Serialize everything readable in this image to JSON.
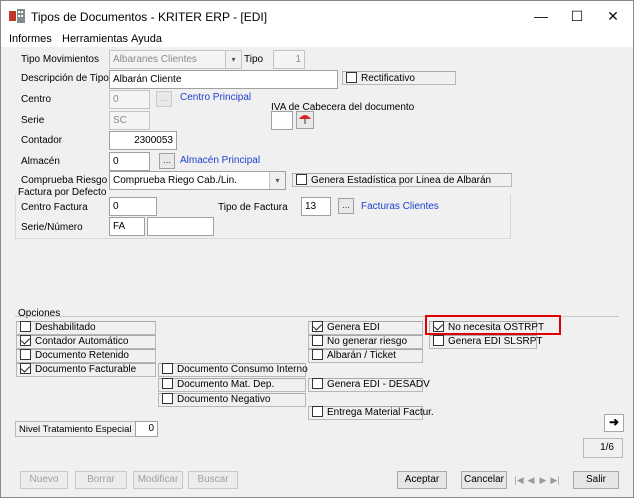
{
  "window": {
    "title": "Tipos de Documentos - KRITER ERP - [EDI]",
    "minimize": "—",
    "maximize": "☐",
    "close": "✕"
  },
  "menu": [
    "Informes",
    "Herramientas",
    "Ayuda"
  ],
  "form": {
    "tipo_movimientos": {
      "label": "Tipo Movimientos",
      "value": "Albaranes Clientes"
    },
    "tipo": {
      "label": "Tipo",
      "value": "1"
    },
    "descripcion": {
      "label": "Descripción de Tipo",
      "value": "Albarán Cliente"
    },
    "rectificativo": {
      "label": "Rectificativo",
      "checked": false
    },
    "centro": {
      "label": "Centro",
      "value": "0",
      "link": "Centro Principal"
    },
    "serie": {
      "label": "Serie",
      "value": "SC"
    },
    "iva": {
      "label": "IVA de Cabecera del documento",
      "value": ""
    },
    "contador": {
      "label": "Contador",
      "value": "2300053"
    },
    "almacen": {
      "label": "Almacén",
      "value": "0",
      "link": "Almacén Principal"
    },
    "compruebe_riesgo": {
      "label": "Comprueba Riesgo",
      "value": "Comprueba Riego Cab./Lin."
    },
    "genera_estadistica": {
      "label": "Genera Estadística por Linea de Albarán",
      "checked": false
    },
    "lookup_button": "...",
    "factura_group": {
      "title": "Factura por Defecto",
      "centro_factura": {
        "label": "Centro Factura",
        "value": "0"
      },
      "tipo_factura": {
        "label": "Tipo de Factura",
        "value": "13",
        "link": "Facturas Clientes"
      },
      "serie_numero": {
        "label": "Serie/Número",
        "value": "FA",
        "value2": ""
      }
    }
  },
  "opciones": {
    "title": "Opciones",
    "col1": [
      {
        "label": "Deshabilitado",
        "checked": false
      },
      {
        "label": "Contador Automático",
        "checked": true
      },
      {
        "label": "Documento Retenido",
        "checked": false
      },
      {
        "label": "Documento Facturable",
        "checked": true
      }
    ],
    "col2": [
      {
        "label": "Documento Consumo Interno",
        "checked": false
      },
      {
        "label": "Documento Mat. Dep.",
        "checked": false
      },
      {
        "label": "Documento Negativo",
        "checked": false
      }
    ],
    "col3": [
      {
        "label": "Genera EDI",
        "checked": true
      },
      {
        "label": "No generar riesgo",
        "checked": false
      },
      {
        "label": "Albarán / Ticket",
        "checked": false
      },
      {
        "label": "Genera EDI - DESADV",
        "checked": false
      },
      {
        "label": "Entrega Material Factur.",
        "checked": false
      }
    ],
    "col4": [
      {
        "label": "No necesita OSTRPT",
        "checked": true
      },
      {
        "label": "Genera EDI SLSRPT",
        "checked": false
      }
    ]
  },
  "nivel_tratamiento": {
    "label": "Nivel Tratamiento Especial",
    "value": "0"
  },
  "page_indicator": "1/6",
  "buttons": {
    "nuevo": "Nuevo",
    "borrar": "Borrar",
    "modificar": "Modificar",
    "buscar": "Buscar",
    "aceptar": "Aceptar",
    "cancelar": "Cancelar",
    "salir": "Salir"
  },
  "colors": {
    "link": "#1f3fd0",
    "highlight": "#e00000"
  }
}
